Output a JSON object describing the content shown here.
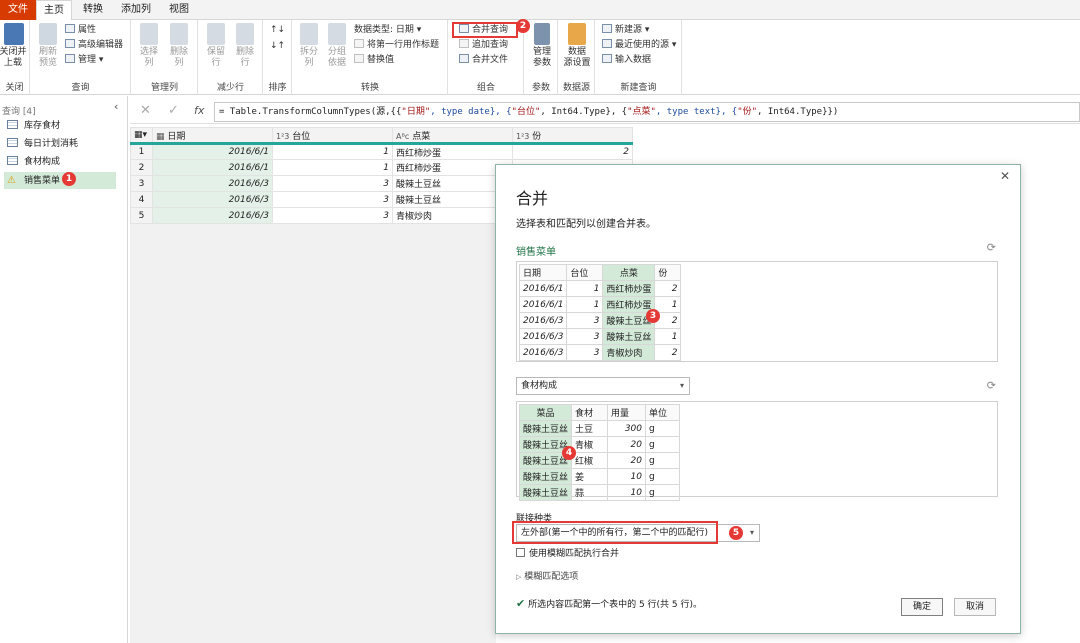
{
  "tabs": {
    "file": "文件",
    "home": "主页",
    "transform": "转换",
    "add_column": "添加列",
    "view": "视图"
  },
  "ribbon": {
    "close_label": "关闭并\n上载",
    "close_dd": "▾",
    "close_group": "关闭",
    "refresh": "刷新\n预览",
    "properties": "属性",
    "advanced_editor": "高级编辑器",
    "manage": "管理",
    "query_group": "查询",
    "choose_columns": "选择\n列",
    "remove_columns": "删除\n列",
    "manage_columns_group": "管理列",
    "keep_rows": "保留\n行",
    "remove_rows": "删除\n行",
    "reduce_rows_group": "减少行",
    "sort_group": "排序",
    "split_column": "拆分\n列",
    "group_by": "分组\n依据",
    "data_type": "数据类型: 日期",
    "first_row_header": "将第一行用作标题",
    "replace_values": "替换值",
    "transform_group": "转换",
    "merge_queries": "合并查询",
    "append_queries": "追加查询",
    "combine_files": "合并文件",
    "combine_group": "组合",
    "manage_params": "管理\n参数",
    "params_group": "参数",
    "data_source_settings": "数据\n源设置",
    "data_sources_group": "数据源",
    "new_source": "新建源",
    "recent_sources": "最近使用的源",
    "enter_data": "输入数据",
    "new_query_group": "新建查询"
  },
  "badges": [
    "1",
    "2",
    "3",
    "4",
    "5"
  ],
  "queries": {
    "header": "查询 [4]",
    "items": [
      "库存食材",
      "每日计划消耗",
      "食材构成",
      "销售菜单"
    ]
  },
  "formula": {
    "prefix": "= Table.TransformColumnTypes(源,{{",
    "p1": "\"日期\"",
    "p2": ", type date}, {",
    "p3": "\"台位\"",
    "p4": ", Int64.Type}, {",
    "p5": "\"点菜\"",
    "p6": ", type text}, {",
    "p7": "\"份\"",
    "p8": ", Int64.Type}})"
  },
  "grid": {
    "headers": [
      "日期",
      "台位",
      "点菜",
      "份"
    ],
    "type_icons": [
      "▦",
      "1²3",
      "Aᴮc",
      "1²3"
    ],
    "rows": [
      [
        "1",
        "2016/6/1",
        "1",
        "西红柿炒蛋",
        "2"
      ],
      [
        "2",
        "2016/6/1",
        "1",
        "西红柿炒蛋",
        ""
      ],
      [
        "3",
        "2016/6/3",
        "3",
        "酸辣土豆丝",
        ""
      ],
      [
        "4",
        "2016/6/3",
        "3",
        "酸辣土豆丝",
        ""
      ],
      [
        "5",
        "2016/6/3",
        "3",
        "青椒炒肉",
        ""
      ]
    ]
  },
  "dialog": {
    "title": "合并",
    "subtitle": "选择表和匹配列以创建合并表。",
    "table1_name": "销售菜单",
    "t1_headers": [
      "日期",
      "台位",
      "点菜",
      "份"
    ],
    "t1_rows": [
      [
        "2016/6/1",
        "1",
        "西红柿炒蛋",
        "2"
      ],
      [
        "2016/6/1",
        "1",
        "西红柿炒蛋",
        "1"
      ],
      [
        "2016/6/3",
        "3",
        "酸辣土豆丝",
        "2"
      ],
      [
        "2016/6/3",
        "3",
        "酸辣土豆丝",
        "1"
      ],
      [
        "2016/6/3",
        "3",
        "青椒炒肉",
        "2"
      ]
    ],
    "table2_select": "食材构成",
    "t2_headers": [
      "菜品",
      "食材",
      "用量",
      "单位"
    ],
    "t2_rows": [
      [
        "酸辣土豆丝",
        "土豆",
        "300",
        "g"
      ],
      [
        "酸辣土豆丝",
        "青椒",
        "20",
        "g"
      ],
      [
        "酸辣土豆丝",
        "红椒",
        "20",
        "g"
      ],
      [
        "酸辣土豆丝",
        "姜",
        "10",
        "g"
      ],
      [
        "酸辣土豆丝",
        "蒜",
        "10",
        "g"
      ]
    ],
    "join_label": "联接种类",
    "join_value": "左外部(第一个中的所有行，第二个中的匹配行)",
    "fuzzy_checkbox": "使用模糊匹配执行合并",
    "fuzzy_options": "模糊匹配选项",
    "status": "所选内容匹配第一个表中的 5 行(共 5 行)。",
    "ok": "确定",
    "cancel": "取消"
  },
  "colors": {
    "accent": "#26a69a",
    "file_tab": "#d83b01",
    "badge": "#e53935",
    "selected_col": "#d4ead9"
  }
}
